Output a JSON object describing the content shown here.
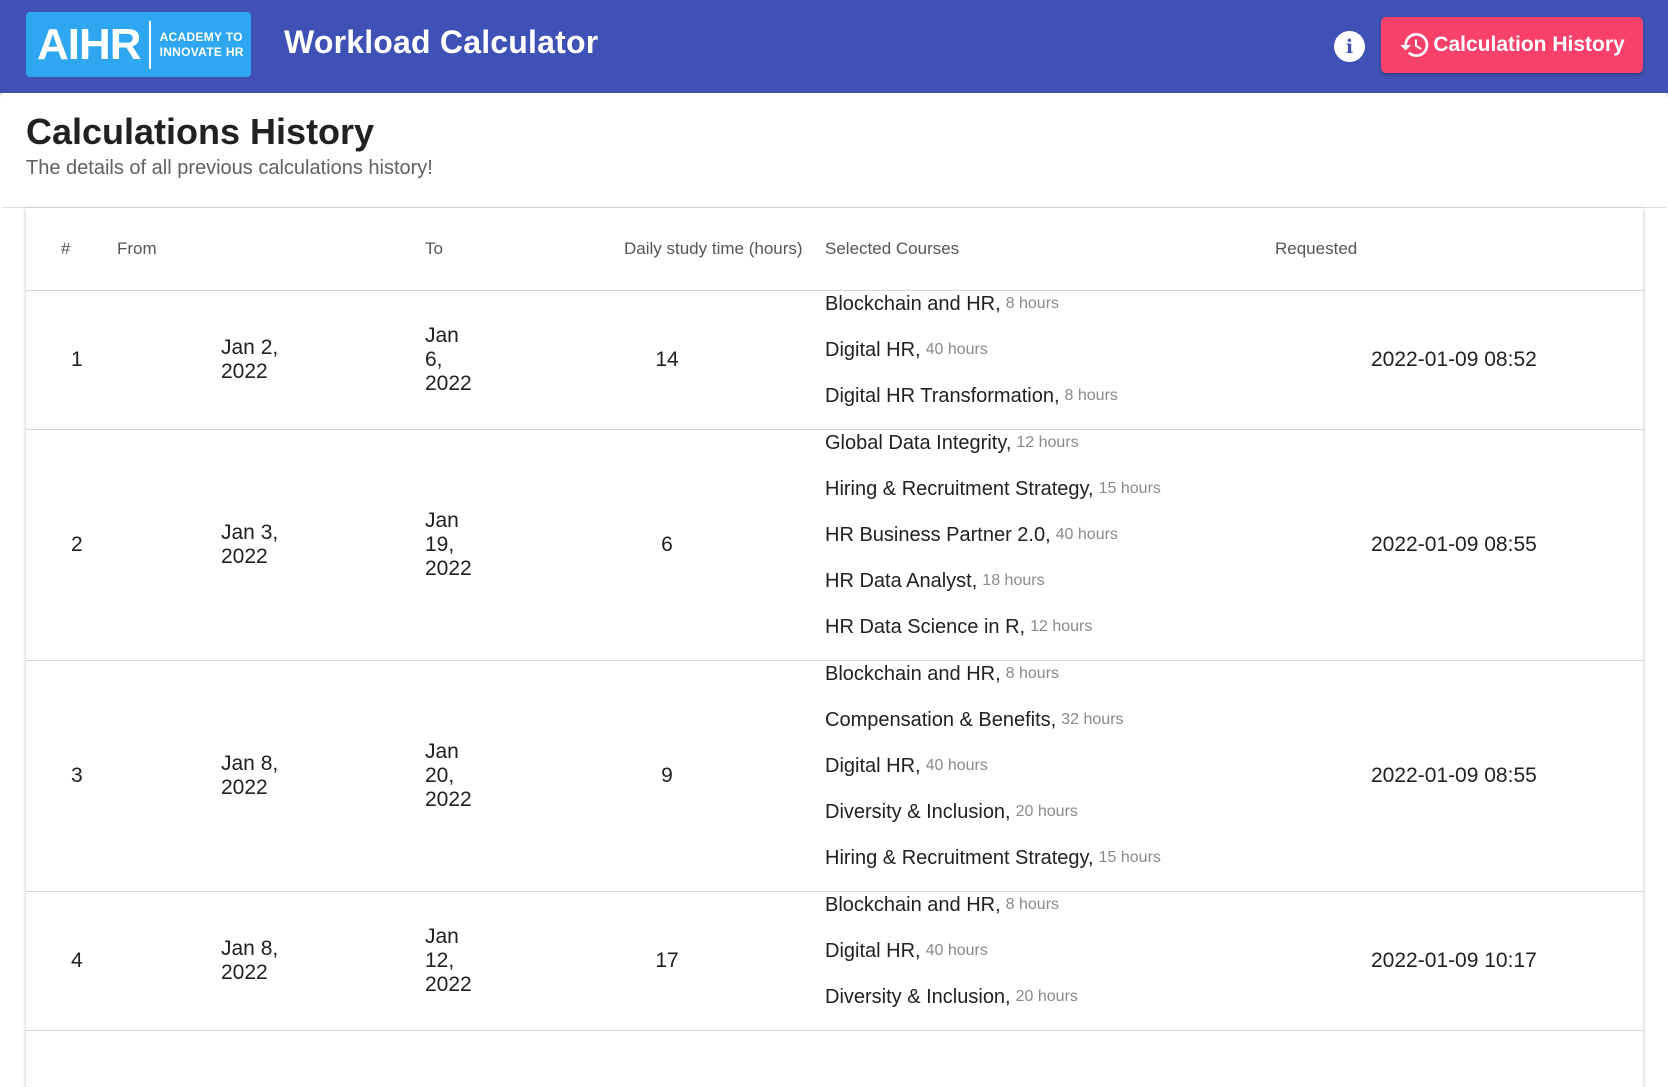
{
  "header": {
    "logo_main": "AIHR",
    "logo_sub_line1": "ACADEMY TO",
    "logo_sub_line2": "INNOVATE HR",
    "app_title": "Workload Calculator",
    "info_icon_glyph": "i",
    "history_button_label": "Calculation History",
    "bar_color": "#3f51b5",
    "button_color": "#f7416b"
  },
  "page": {
    "title": "Calculations History",
    "subtitle": "The details of all previous calculations history!"
  },
  "table": {
    "columns": [
      "#",
      "From",
      "To",
      "Daily study time (hours)",
      "Selected Courses",
      "Requested"
    ],
    "rows": [
      {
        "num": "1",
        "from": "Jan 2, 2022",
        "to": "Jan 6, 2022",
        "daily": "14",
        "courses": [
          {
            "name": "Blockchain and HR,",
            "hours": "8 hours"
          },
          {
            "name": "Digital HR,",
            "hours": "40 hours"
          },
          {
            "name": "Digital HR Transformation,",
            "hours": "8 hours"
          }
        ],
        "requested": "2022-01-09 08:52"
      },
      {
        "num": "2",
        "from": "Jan 3, 2022",
        "to": "Jan 19, 2022",
        "daily": "6",
        "courses": [
          {
            "name": "Global Data Integrity,",
            "hours": "12 hours"
          },
          {
            "name": "Hiring & Recruitment Strategy,",
            "hours": "15 hours"
          },
          {
            "name": "HR Business Partner 2.0,",
            "hours": "40 hours"
          },
          {
            "name": "HR Data Analyst,",
            "hours": "18 hours"
          },
          {
            "name": "HR Data Science in R,",
            "hours": "12 hours"
          }
        ],
        "requested": "2022-01-09 08:55"
      },
      {
        "num": "3",
        "from": "Jan 8, 2022",
        "to": "Jan 20, 2022",
        "daily": "9",
        "courses": [
          {
            "name": "Blockchain and HR,",
            "hours": "8 hours"
          },
          {
            "name": "Compensation & Benefits,",
            "hours": "32 hours"
          },
          {
            "name": "Digital HR,",
            "hours": "40 hours"
          },
          {
            "name": "Diversity & Inclusion,",
            "hours": "20 hours"
          },
          {
            "name": "Hiring & Recruitment Strategy,",
            "hours": "15 hours"
          }
        ],
        "requested": "2022-01-09 08:55"
      },
      {
        "num": "4",
        "from": "Jan 8, 2022",
        "to": "Jan 12, 2022",
        "daily": "17",
        "courses": [
          {
            "name": "Blockchain and HR,",
            "hours": "8 hours"
          },
          {
            "name": "Digital HR,",
            "hours": "40 hours"
          },
          {
            "name": "Diversity & Inclusion,",
            "hours": "20 hours"
          }
        ],
        "requested": "2022-01-09 10:17"
      }
    ]
  }
}
